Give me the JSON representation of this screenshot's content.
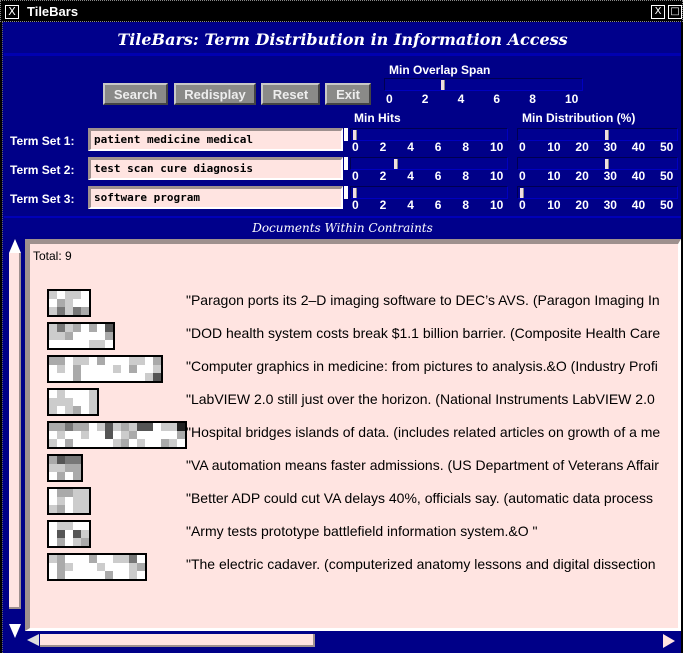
{
  "window": {
    "title": "TileBars",
    "app_icon": "x-window-icon",
    "controls": [
      "close-icon",
      "maximize-icon"
    ]
  },
  "header": {
    "title": "TileBars: Term Distribution in Information Access"
  },
  "toolbar": {
    "search_label": "Search",
    "redisplay_label": "Redisplay",
    "reset_label": "Reset",
    "exit_label": "Exit"
  },
  "overlap": {
    "label": "Min Overlap Span",
    "value": 3,
    "ticks": [
      "0",
      "2",
      "4",
      "6",
      "8",
      "10"
    ],
    "max": 11
  },
  "min_hits": {
    "label": "Min Hits",
    "ticks": [
      "0",
      "2",
      "4",
      "6",
      "8",
      "10"
    ],
    "max": 11
  },
  "min_dist": {
    "label": "Min Distribution (%)",
    "ticks": [
      "0",
      "10",
      "20",
      "30",
      "40",
      "50"
    ],
    "max": 55
  },
  "term_sets": [
    {
      "label": "Term Set 1:",
      "value": "patient medicine medical",
      "min_hits": 0,
      "min_distribution": 30
    },
    {
      "label": "Term Set 2:",
      "value": "test scan cure diagnosis",
      "min_hits": 3,
      "min_distribution": 30
    },
    {
      "label": "Term Set 3:",
      "value": "software program",
      "min_hits": 0,
      "min_distribution": 0
    }
  ],
  "documents_header": "Documents Within Contraints",
  "total_label": "Total: 9",
  "shade_colors": {
    "w": "#ffffff",
    "l": "#cccccc",
    "m": "#aaaaaa",
    "d": "#777777",
    "k": "#555555",
    "x": "#222222"
  },
  "documents": [
    {
      "title": "\"Paragon ports its 2–D imaging software to DEC’s AVS. (Paragon Imaging In",
      "tiles": [
        "lwllw",
        "wmlww",
        "ldldm"
      ]
    },
    {
      "title": "\"DOD health system costs break $1.1 billion barrier. (Composite Health Care",
      "tiles": [
        "ldlmwmwk",
        "llmwwwwm",
        "wwwwwllw"
      ]
    },
    {
      "title": "\"Computer graphics in medicine: from pictures to analysis.&O  (Industry Profi",
      "tiles": [
        "mmwllwmwwwllwm",
        "wlwmwwwwlwmwwl",
        "wwwmwwwwwwwwlk"
      ]
    },
    {
      "title": "\"LabVIEW 2.0 still just over the horizon. (National Instruments LabVIEW 2.0",
      "tiles": [
        "wlwwwl",
        "lllwwl",
        "lwlmwl"
      ]
    },
    {
      "title": "\"Hospital bridges islands of data. (includes related articles on growth of a me",
      "tiles": [
        "mmdmmwlklmlkkwllx",
        "wlwwlwwkwlmwwwwwm",
        "lwmwwwwwlmwlwwmlw"
      ]
    },
    {
      "title": "\"VA automation means faster admissions. (US Department of Veterans Affair",
      "tiles": [
        "mkdd",
        "llmm",
        "wmwm"
      ]
    },
    {
      "title": "\"Better ADP could cut VA delays 40%, officials say. (automatic data process",
      "tiles": [
        "wmmll",
        "wlwll",
        "lmwll"
      ]
    },
    {
      "title": "\"Army tests prototype battlefield information system.&O \"",
      "tiles": [
        "wllww",
        "wkwkl",
        "wmwlm"
      ]
    },
    {
      "title": "\"The electric cadaver. (computerized anatomy lessons and digital dissection",
      "tiles": [
        "lmwwwmwwlldw",
        "wmlwwwlwwwlm",
        "wmwwwwwmwwlw"
      ]
    }
  ]
}
